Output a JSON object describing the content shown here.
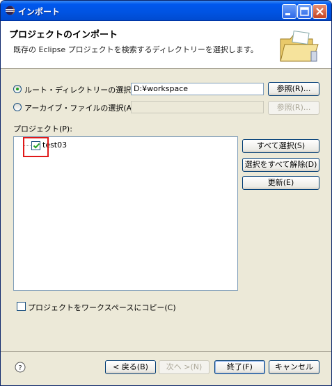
{
  "window": {
    "title": "インポート"
  },
  "header": {
    "title": "プロジェクトのインポート",
    "description": "既存の Eclipse プロジェクトを検索するディレクトリーを選択します。"
  },
  "root_dir": {
    "label": "ルート・ディレクトリーの選択(T):",
    "value": "D:¥workspace",
    "browse_label": "参照(R)...",
    "selected": true
  },
  "archive": {
    "label": "アーカイブ・ファイルの選択(A):",
    "value": "",
    "browse_label": "参照(R)...",
    "selected": false
  },
  "projects": {
    "label": "プロジェクト(P):",
    "items": [
      {
        "name": "test03",
        "checked": true
      }
    ],
    "select_all_label": "すべて選択(S)",
    "deselect_all_label": "選択をすべて解除(D)",
    "refresh_label": "更新(E)"
  },
  "copy_option": {
    "label": "プロジェクトをワークスペースにコピー(C)",
    "checked": false
  },
  "footer": {
    "back_label": "< 戻る(B)",
    "next_label": "次へ >(N)",
    "finish_label": "終了(F)",
    "cancel_label": "キャンセル"
  },
  "colors": {
    "titlebar": "#0053e2",
    "highlight": "#e01818",
    "accent": "#21a121"
  }
}
